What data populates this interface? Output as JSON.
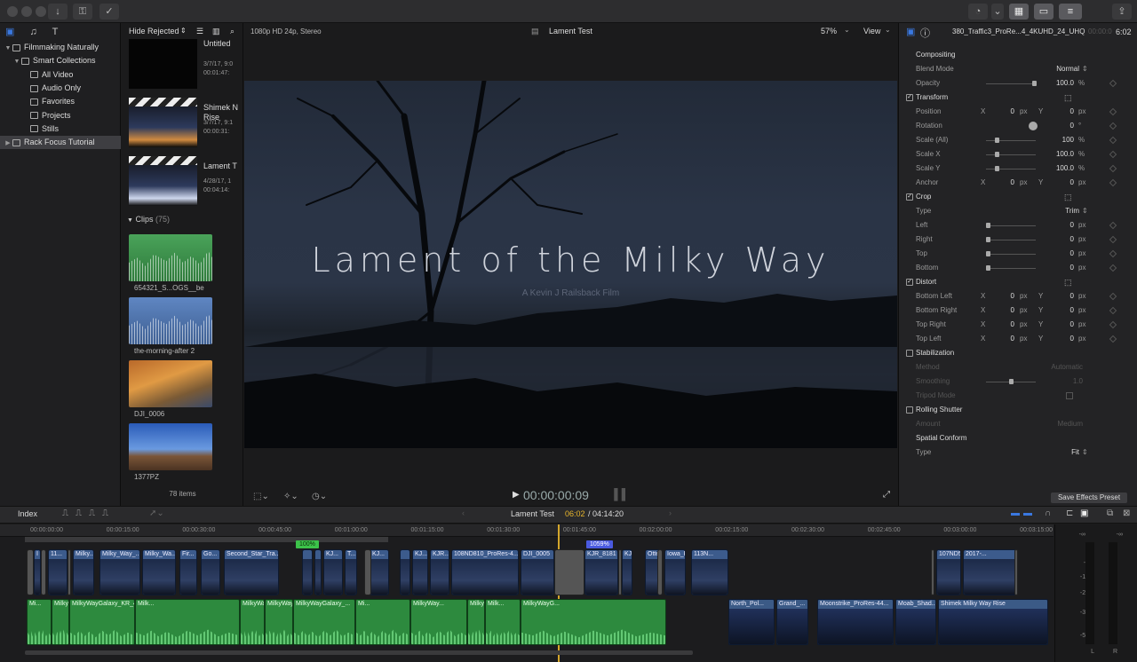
{
  "toolbar": {
    "buttons": [
      "import-icon",
      "keyword-icon",
      "check-icon"
    ],
    "right_buttons": [
      "background-tasks-icon",
      "layout-icon",
      "layout-icon",
      "adjust-icon",
      "share-icon"
    ]
  },
  "libraries": {
    "items": [
      {
        "label": "Filmmaking Naturally",
        "level": 0,
        "expanded": true
      },
      {
        "label": "Smart Collections",
        "level": 1,
        "expanded": true
      },
      {
        "label": "All Video",
        "level": 2
      },
      {
        "label": "Audio Only",
        "level": 2
      },
      {
        "label": "Favorites",
        "level": 2
      },
      {
        "label": "Projects",
        "level": 2
      },
      {
        "label": "Stills",
        "level": 2
      },
      {
        "label": "Rack Focus Tutorial",
        "level": 0,
        "selected": true
      }
    ]
  },
  "browser": {
    "filter": "Hide Rejected",
    "projects": [
      {
        "name": "Untitled",
        "date": "3/7/17, 9:0",
        "duration": "00:01:47:"
      },
      {
        "name": "Shimek N Rise",
        "date": "3/7/17, 9:1",
        "duration": "00:00:31:"
      },
      {
        "name": "Lament T",
        "date": "4/28/17, 1",
        "duration": "00:04:14:"
      }
    ],
    "clips_label": "Clips",
    "clips_count": "(75)",
    "clips": [
      {
        "name": "654321_S...OGS__be",
        "kind": "audio-green"
      },
      {
        "name": "the-morning-after 2",
        "kind": "audio-blue"
      },
      {
        "name": "DJI_0006",
        "kind": "video-orange"
      },
      {
        "name": "1377PZ",
        "kind": "video-sky"
      }
    ],
    "item_count": "78 items"
  },
  "viewer": {
    "format": "1080p HD 24p, Stereo",
    "project_name": "Lament Test",
    "zoom": "57%",
    "view_label": "View",
    "title": "Lament of the Milky Way",
    "subtitle": "A Kevin J Railsback Film",
    "timecode": "00:00:00:09"
  },
  "inspector": {
    "clip_name": "380_Traffic3_ProRe...4_4KUHD_24_UHQ",
    "duration_prefix": "00:00:0",
    "duration": "6:02",
    "sections": [
      {
        "title": "Compositing",
        "checkbox": false,
        "rows": [
          {
            "label": "Blend Mode",
            "value": "Normal",
            "type": "popup"
          },
          {
            "label": "Opacity",
            "value": "100.0",
            "unit": "%",
            "slider": 1.0
          }
        ]
      },
      {
        "title": "Transform",
        "checkbox": true,
        "rows": [
          {
            "label": "Position",
            "x": "0",
            "y": "0",
            "unit": "px"
          },
          {
            "label": "Rotation",
            "value": "0",
            "unit": "°",
            "dial": true
          },
          {
            "label": "Scale (All)",
            "value": "100",
            "unit": "%",
            "slider": 0.2
          },
          {
            "label": "Scale X",
            "value": "100.0",
            "unit": "%",
            "slider": 0.2
          },
          {
            "label": "Scale Y",
            "value": "100.0",
            "unit": "%",
            "slider": 0.2
          },
          {
            "label": "Anchor",
            "x": "0",
            "y": "0",
            "unit": "px"
          }
        ]
      },
      {
        "title": "Crop",
        "checkbox": true,
        "rows": [
          {
            "label": "Type",
            "value": "Trim",
            "type": "popup"
          },
          {
            "label": "Left",
            "value": "0",
            "unit": "px",
            "slider": 0.0
          },
          {
            "label": "Right",
            "value": "0",
            "unit": "px",
            "slider": 0.0
          },
          {
            "label": "Top",
            "value": "0",
            "unit": "px",
            "slider": 0.0
          },
          {
            "label": "Bottom",
            "value": "0",
            "unit": "px",
            "slider": 0.0
          }
        ]
      },
      {
        "title": "Distort",
        "checkbox": true,
        "rows": [
          {
            "label": "Bottom Left",
            "x": "0",
            "y": "0",
            "unit": "px"
          },
          {
            "label": "Bottom Right",
            "x": "0",
            "y": "0",
            "unit": "px"
          },
          {
            "label": "Top Right",
            "x": "0",
            "y": "0",
            "unit": "px"
          },
          {
            "label": "Top Left",
            "x": "0",
            "y": "0",
            "unit": "px"
          }
        ]
      },
      {
        "title": "Stabilization",
        "checkbox": false,
        "unchecked": true,
        "rows": [
          {
            "label": "Method",
            "value": "Automatic",
            "dim": true
          },
          {
            "label": "Smoothing",
            "value": "1.0",
            "dim": true,
            "slider": 0.5
          },
          {
            "label": "Tripod Mode",
            "value": "",
            "dim": true,
            "checkbox": true
          }
        ]
      },
      {
        "title": "Rolling Shutter",
        "checkbox": false,
        "unchecked": true,
        "rows": [
          {
            "label": "Amount",
            "value": "Medium",
            "dim": true
          }
        ]
      },
      {
        "title": "Spatial Conform",
        "checkbox": false,
        "rows": [
          {
            "label": "Type",
            "value": "Fit",
            "type": "popup"
          }
        ]
      }
    ],
    "save_preset": "Save Effects Preset"
  },
  "timeline_bar": {
    "index": "Index",
    "project": "Lament Test",
    "position": "06:02",
    "total": "/ 04:14:20"
  },
  "ruler": [
    "00:00:00:00",
    "00:00:15:00",
    "00:00:30:00",
    "00:00:45:00",
    "00:01:00:00",
    "00:01:15:00",
    "00:01:30:00",
    "00:01:45:00",
    "00:02:00:00",
    "00:02:15:00",
    "00:02:30:00",
    "00:02:45:00",
    "00:03:00:00",
    "00:03:15:00"
  ],
  "speed_badges": [
    "100%",
    "1059%"
  ],
  "video_clips": [
    "I",
    "11...",
    "Milky...",
    "Milky_Way_...",
    "Milky_Wa...",
    "Fir...",
    "Go...",
    "Second_Star_Tra...",
    "",
    "",
    "KJ...",
    "T...",
    "KJ...",
    "",
    "KJ...",
    "KJR...",
    "108ND810_ProRes-4...",
    "DJI_0005",
    "KJR_8181",
    "KJ...",
    "Otte...",
    "Iowa_Rive...",
    "113N...",
    "107ND500_h264...",
    "2017-..."
  ],
  "audio_clips": [
    "Mi...",
    "MilkyWayGalaxy_KR...",
    "MilkyWayGalaxy_KR_4-10-17_KC",
    "Milk...",
    "MilkyWayGalaxy_K...",
    "MilkyWayGala...",
    "MilkyWayGalaxy_...",
    "Mi...",
    "MilkyWay...",
    "MilkyWayGalaxy_KR_4-10-17_KC",
    "Milk...",
    "MilkyWayG..."
  ],
  "broll_clips": [
    "North_Pol...",
    "Grand_...",
    "Moonstrike_ProRes-44...",
    "Moab_Shad...",
    "Shimek Milky Way Rise"
  ],
  "meters": {
    "labels": [
      "-∞",
      "-∞",
      "0",
      "-6",
      "-12",
      "-20",
      "-30",
      "-50"
    ],
    "channels": [
      "L",
      "R"
    ]
  }
}
